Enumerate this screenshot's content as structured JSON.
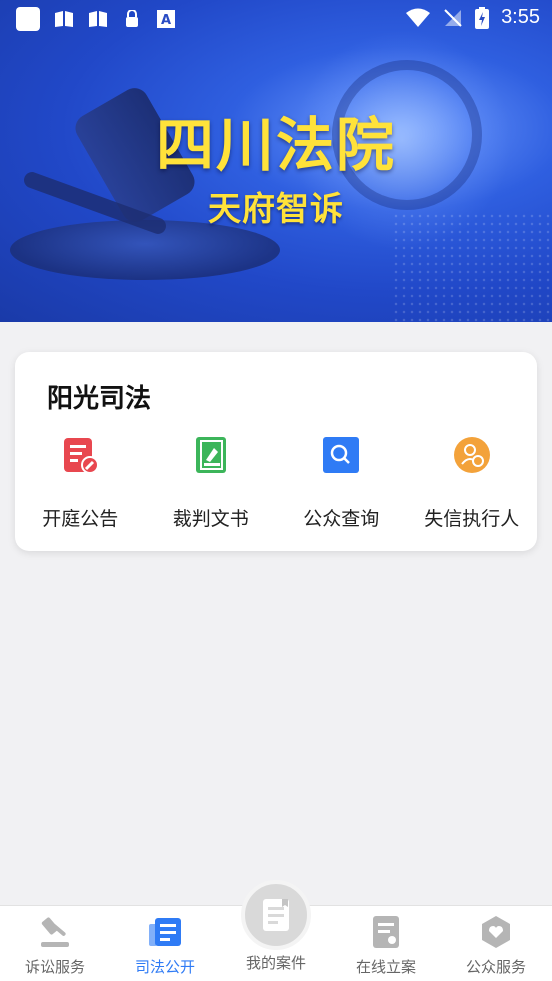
{
  "status_bar": {
    "time": "3:55"
  },
  "banner": {
    "title": "四川法院",
    "subtitle": "天府智诉"
  },
  "card": {
    "title": "阳光司法",
    "items": [
      {
        "label": "开庭公告",
        "icon": "court-notice-icon",
        "color": "#e8474f"
      },
      {
        "label": "裁判文书",
        "icon": "judgment-document-icon",
        "color": "#3cb55a"
      },
      {
        "label": "公众查询",
        "icon": "search-icon",
        "color": "#2f7bf5"
      },
      {
        "label": "失信执行人",
        "icon": "dishonest-person-icon",
        "color": "#f3a23a"
      }
    ]
  },
  "tabbar": {
    "items": [
      {
        "label": "诉讼服务",
        "icon": "gavel-icon",
        "active": false
      },
      {
        "label": "司法公开",
        "icon": "news-icon",
        "active": true
      },
      {
        "label": "我的案件",
        "icon": "case-book-icon",
        "active": false
      },
      {
        "label": "在线立案",
        "icon": "filing-icon",
        "active": false
      },
      {
        "label": "公众服务",
        "icon": "public-service-icon",
        "active": false
      }
    ],
    "active_color": "#2f7bf5"
  }
}
